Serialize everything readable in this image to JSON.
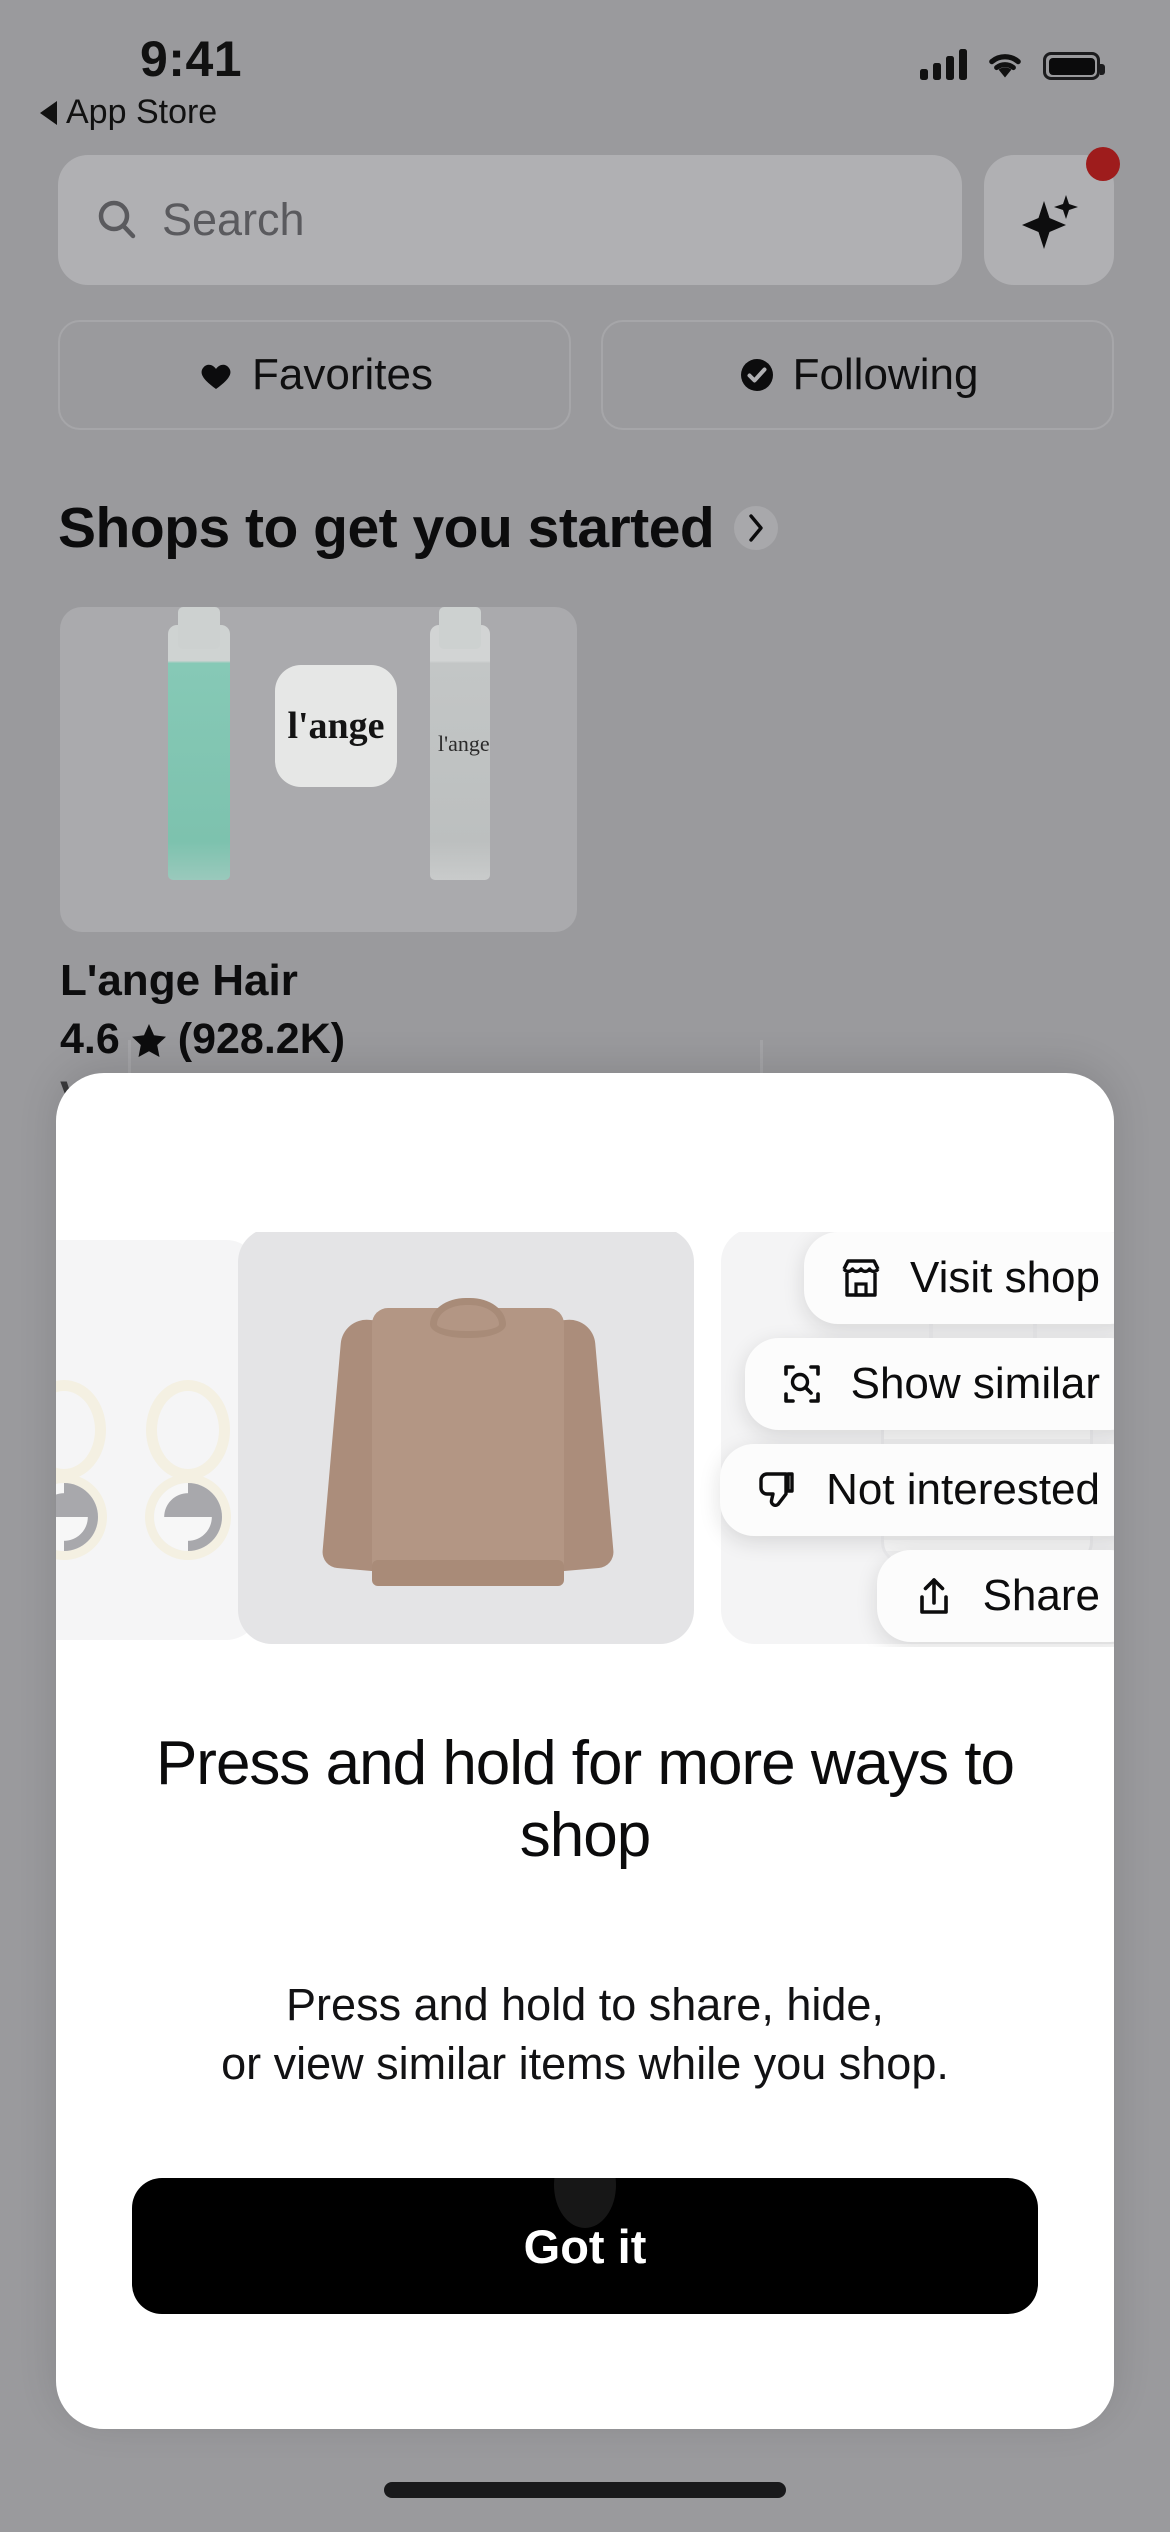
{
  "status_bar": {
    "time": "9:41",
    "back_label": "App Store",
    "icons": [
      "cellular-signal-icon",
      "wifi-icon",
      "battery-icon"
    ]
  },
  "search": {
    "placeholder": "Search",
    "icon": "search-icon",
    "ai_button_icon": "sparkle-icon",
    "ai_badge_color": "#9e1c1c"
  },
  "filters": [
    {
      "label": "Favorites",
      "icon": "heart-icon"
    },
    {
      "label": "Following",
      "icon": "check-circle-icon"
    }
  ],
  "section": {
    "title": "Shops to get you started",
    "chevron_icon": "chevron-right-icon"
  },
  "shop_card": {
    "logo_text": "l'ange",
    "bottle_label": "l'ange",
    "name": "L'ange Hair",
    "rating": "4.6",
    "star_icon": "star-icon",
    "review_count": "(928.2K)",
    "cta": "Visit shop"
  },
  "sheet": {
    "title": "Press and hold for more ways to shop",
    "subtitle_line1": "Press and hold to share, hide,",
    "subtitle_line2": "or view similar items while you shop.",
    "cta_label": "Got it",
    "cta_bg": "#000000",
    "cta_color": "#ffffff",
    "context_menu": [
      {
        "label": "Visit shop",
        "icon": "storefront-icon"
      },
      {
        "label": "Show similar",
        "icon": "visual-search-icon"
      },
      {
        "label": "Not interested",
        "icon": "thumbs-down-icon"
      },
      {
        "label": "Share",
        "icon": "share-icon"
      }
    ],
    "products": [
      {
        "name": "yin-yang-hoop-earrings"
      },
      {
        "name": "tan-crewneck-sweatshirt"
      },
      {
        "name": "white-hardshell-suitcase"
      }
    ]
  },
  "colors": {
    "dim_overlay": "#9a9a9d",
    "sheet_bg": "#ffffff",
    "accent_dark": "#000000"
  }
}
